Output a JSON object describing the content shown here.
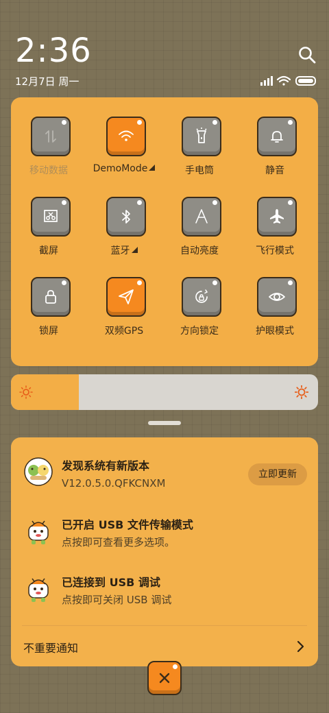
{
  "status_bar": {
    "time": "2:36",
    "date": "12月7日 周一",
    "icons": [
      "signal-icon",
      "wifi-icon",
      "battery-icon"
    ],
    "search_icon": "search-icon"
  },
  "quick_settings": {
    "tiles": [
      {
        "label": "移动数据",
        "icon": "mobile-data-icon",
        "active": false,
        "disabled": true
      },
      {
        "label": "DemoMode",
        "icon": "wifi-icon",
        "active": true,
        "expandable": true
      },
      {
        "label": "手电筒",
        "icon": "flashlight-icon",
        "active": false
      },
      {
        "label": "静音",
        "icon": "bell-icon",
        "active": false
      },
      {
        "label": "截屏",
        "icon": "screenshot-icon",
        "active": false
      },
      {
        "label": "蓝牙",
        "icon": "bluetooth-icon",
        "active": false,
        "expandable": true
      },
      {
        "label": "自动亮度",
        "icon": "auto-brightness-icon",
        "active": false
      },
      {
        "label": "飞行模式",
        "icon": "airplane-icon",
        "active": false
      },
      {
        "label": "锁屏",
        "icon": "lock-icon",
        "active": false
      },
      {
        "label": "双频GPS",
        "icon": "gps-icon",
        "active": true
      },
      {
        "label": "方向锁定",
        "icon": "rotation-lock-icon",
        "active": false
      },
      {
        "label": "护眼模式",
        "icon": "eye-icon",
        "active": false
      }
    ],
    "page_count": 2,
    "current_page": 1
  },
  "brightness": {
    "level": 0.22,
    "low_icon": "sun-small-icon",
    "high_icon": "sun-large-icon"
  },
  "notifications": [
    {
      "title": "发现系统有新版本",
      "subtitle": "V12.0.5.0.QFKCNXM",
      "action": "立即更新",
      "icon": "app-icon"
    },
    {
      "title": "已开启 USB 文件传输模式",
      "subtitle": "点按即可查看更多选项。",
      "icon": "android-icon"
    },
    {
      "title": "已连接到 USB 调试",
      "subtitle": "点按即可关闭 USB 调试",
      "icon": "android-icon"
    }
  ],
  "unimportant": {
    "label": "不重要通知",
    "icon": "chevron-right-icon"
  },
  "close": {
    "icon": "close-icon"
  },
  "colors": {
    "panel": "#f3ae46",
    "tile_inactive": "#8f8d86",
    "tile_active": "#f5891f",
    "outline": "#3a2c1a",
    "label_dim": "#b18e58"
  }
}
